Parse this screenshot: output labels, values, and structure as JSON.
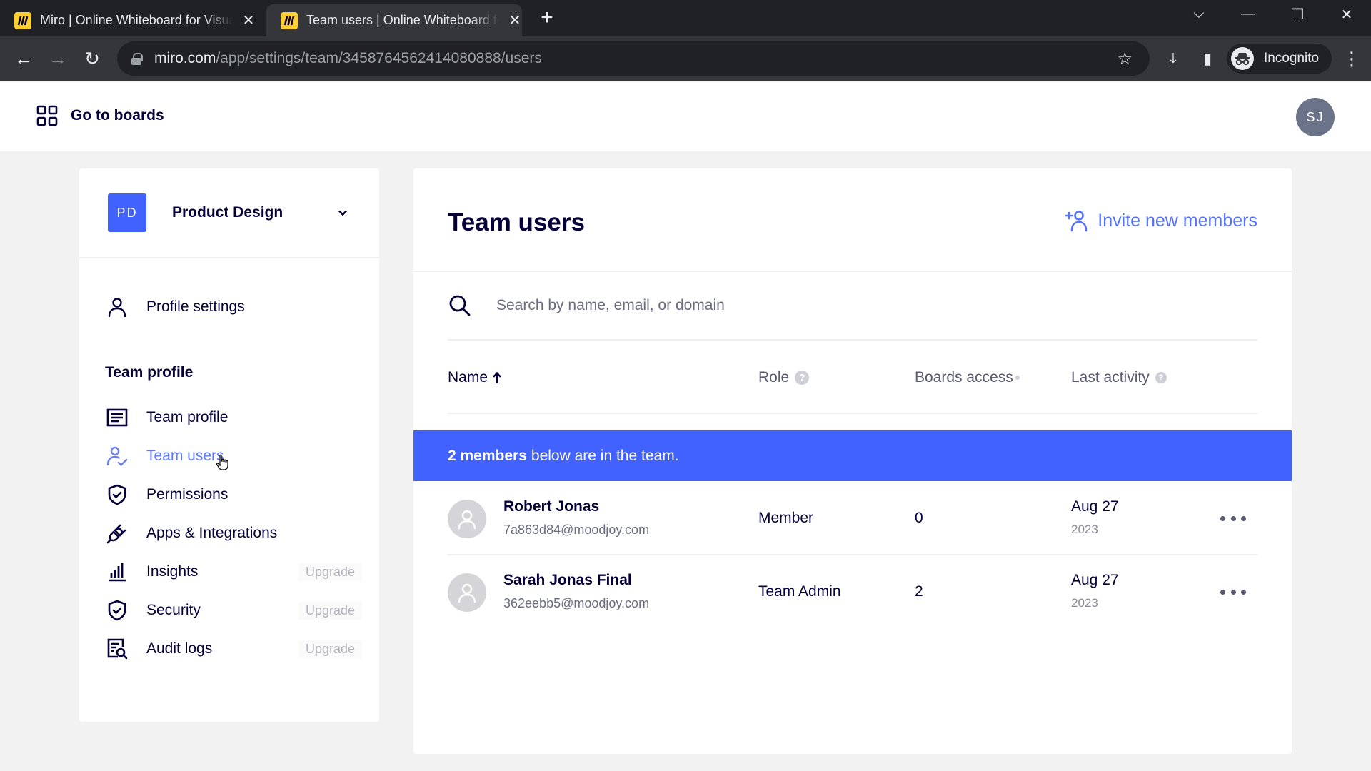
{
  "browser": {
    "tabs": [
      {
        "title": "Miro | Online Whiteboard for Visual Collaboration",
        "active": false
      },
      {
        "title": "Team users | Online Whiteboard for Visual Collaboration",
        "active": true
      }
    ],
    "url_host": "miro.com",
    "url_path": "/app/settings/team/3458764562414080888/users",
    "profile_label": "Incognito"
  },
  "header": {
    "go_to_boards": "Go to boards",
    "user_initials": "SJ"
  },
  "sidebar": {
    "team": {
      "initials": "PD",
      "name": "Product Design"
    },
    "profile_settings": "Profile settings",
    "section_heading": "Team profile",
    "items": [
      {
        "label": "Team profile",
        "icon": "list-icon",
        "badge": null,
        "active": false
      },
      {
        "label": "Team users",
        "icon": "user-check-icon",
        "badge": null,
        "active": true
      },
      {
        "label": "Permissions",
        "icon": "shield-check-icon",
        "badge": null,
        "active": false
      },
      {
        "label": "Apps & Integrations",
        "icon": "plug-icon",
        "badge": null,
        "active": false
      },
      {
        "label": "Insights",
        "icon": "bar-chart-icon",
        "badge": "Upgrade",
        "active": false
      },
      {
        "label": "Security",
        "icon": "shield-check-icon",
        "badge": "Upgrade",
        "active": false
      },
      {
        "label": "Audit logs",
        "icon": "audit-log-icon",
        "badge": "Upgrade",
        "active": false
      }
    ]
  },
  "main": {
    "title": "Team users",
    "invite_label": "Invite new members",
    "search_placeholder": "Search by name, email, or domain",
    "search_value": "",
    "columns": {
      "name": "Name",
      "role": "Role",
      "boards_access": "Boards access",
      "last_activity": "Last activity"
    },
    "sort": {
      "column": "name",
      "direction": "ascending"
    },
    "banner": {
      "count_text": "2 members",
      "rest_text": "below are in the team."
    },
    "accent_color": "#4262ff",
    "members": [
      {
        "name": "Robert Jonas",
        "email": "7a863d84@moodjoy.com",
        "role": "Member",
        "boards": "0",
        "last_activity_date": "Aug 27",
        "last_activity_year": "2023"
      },
      {
        "name": "Sarah Jonas Final",
        "email": "362eebb5@moodjoy.com",
        "role": "Team Admin",
        "boards": "2",
        "last_activity_date": "Aug 27",
        "last_activity_year": "2023"
      }
    ]
  }
}
